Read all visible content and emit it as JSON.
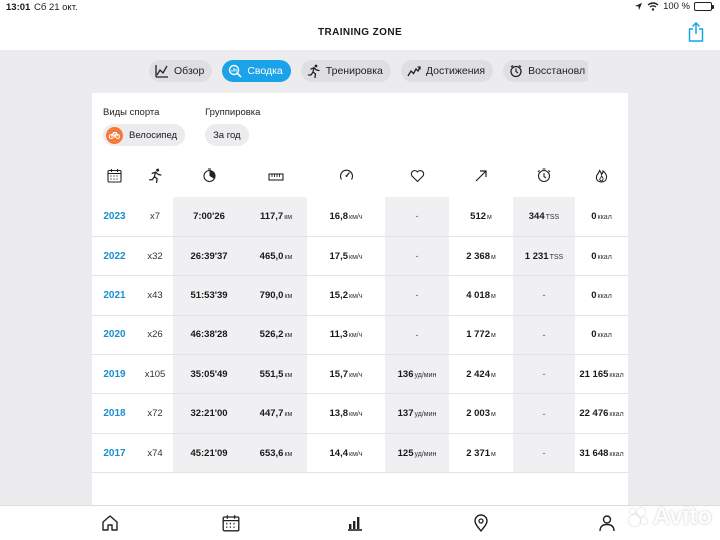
{
  "status_bar": {
    "time": "13:01",
    "date": "Сб 21 окт.",
    "battery": "100 %"
  },
  "app": {
    "title": "TRAINING ZONE"
  },
  "tabs": [
    {
      "label": "Обзор",
      "icon": "chart-icon",
      "active": false
    },
    {
      "label": "Сводка",
      "icon": "summary-icon",
      "active": true
    },
    {
      "label": "Тренировка",
      "icon": "runner-icon",
      "active": false
    },
    {
      "label": "Достижения",
      "icon": "trend-icon",
      "active": false
    },
    {
      "label": "Восстановл",
      "icon": "recovery-icon",
      "active": false
    }
  ],
  "filters": {
    "sport_label": "Виды спорта",
    "sport_value": "Велосипед",
    "group_label": "Группировка",
    "group_value": "За год"
  },
  "columns": [
    "calendar-icon",
    "runner-icon",
    "timer-icon",
    "ruler-icon",
    "speedometer-icon",
    "heart-icon",
    "ascent-icon",
    "tss-icon",
    "flame-icon"
  ],
  "rows": [
    {
      "year": "2023",
      "count": "x7",
      "duration": "7:00'26",
      "distance": "117,7",
      "dist_unit": "км",
      "speed": "16,8",
      "speed_unit": "км/ч",
      "hr": "-",
      "hr_unit": "",
      "ascent": "512",
      "ascent_unit": "м",
      "tss": "344",
      "tss_unit": "TSS",
      "kcal": "0",
      "kcal_unit": "ккал"
    },
    {
      "year": "2022",
      "count": "x32",
      "duration": "26:39'37",
      "distance": "465,0",
      "dist_unit": "км",
      "speed": "17,5",
      "speed_unit": "км/ч",
      "hr": "-",
      "hr_unit": "",
      "ascent": "2 368",
      "ascent_unit": "м",
      "tss": "1 231",
      "tss_unit": "TSS",
      "kcal": "0",
      "kcal_unit": "ккал"
    },
    {
      "year": "2021",
      "count": "x43",
      "duration": "51:53'39",
      "distance": "790,0",
      "dist_unit": "км",
      "speed": "15,2",
      "speed_unit": "км/ч",
      "hr": "-",
      "hr_unit": "",
      "ascent": "4 018",
      "ascent_unit": "м",
      "tss": "-",
      "tss_unit": "",
      "kcal": "0",
      "kcal_unit": "ккал"
    },
    {
      "year": "2020",
      "count": "x26",
      "duration": "46:38'28",
      "distance": "526,2",
      "dist_unit": "км",
      "speed": "11,3",
      "speed_unit": "км/ч",
      "hr": "-",
      "hr_unit": "",
      "ascent": "1 772",
      "ascent_unit": "м",
      "tss": "-",
      "tss_unit": "",
      "kcal": "0",
      "kcal_unit": "ккал"
    },
    {
      "year": "2019",
      "count": "x105",
      "duration": "35:05'49",
      "distance": "551,5",
      "dist_unit": "км",
      "speed": "15,7",
      "speed_unit": "км/ч",
      "hr": "136",
      "hr_unit": "уд/мин",
      "ascent": "2 424",
      "ascent_unit": "м",
      "tss": "-",
      "tss_unit": "",
      "kcal": "21 165",
      "kcal_unit": "ккал"
    },
    {
      "year": "2018",
      "count": "x72",
      "duration": "32:21'00",
      "distance": "447,7",
      "dist_unit": "км",
      "speed": "13,8",
      "speed_unit": "км/ч",
      "hr": "137",
      "hr_unit": "уд/мин",
      "ascent": "2 003",
      "ascent_unit": "м",
      "tss": "-",
      "tss_unit": "",
      "kcal": "22 476",
      "kcal_unit": "ккал"
    },
    {
      "year": "2017",
      "count": "x74",
      "duration": "45:21'09",
      "distance": "653,6",
      "dist_unit": "км",
      "speed": "14,4",
      "speed_unit": "км/ч",
      "hr": "125",
      "hr_unit": "уд/мин",
      "ascent": "2 371",
      "ascent_unit": "м",
      "tss": "-",
      "tss_unit": "",
      "kcal": "31 648",
      "kcal_unit": "ккал"
    }
  ],
  "bottom_nav": [
    "home-icon",
    "calendar-icon",
    "stats-icon",
    "location-icon",
    "profile-icon"
  ],
  "watermark": "Avito",
  "colors": {
    "accent": "#1aa3e8",
    "year_link": "#1a8fd0",
    "sport": "#f47a3a"
  }
}
